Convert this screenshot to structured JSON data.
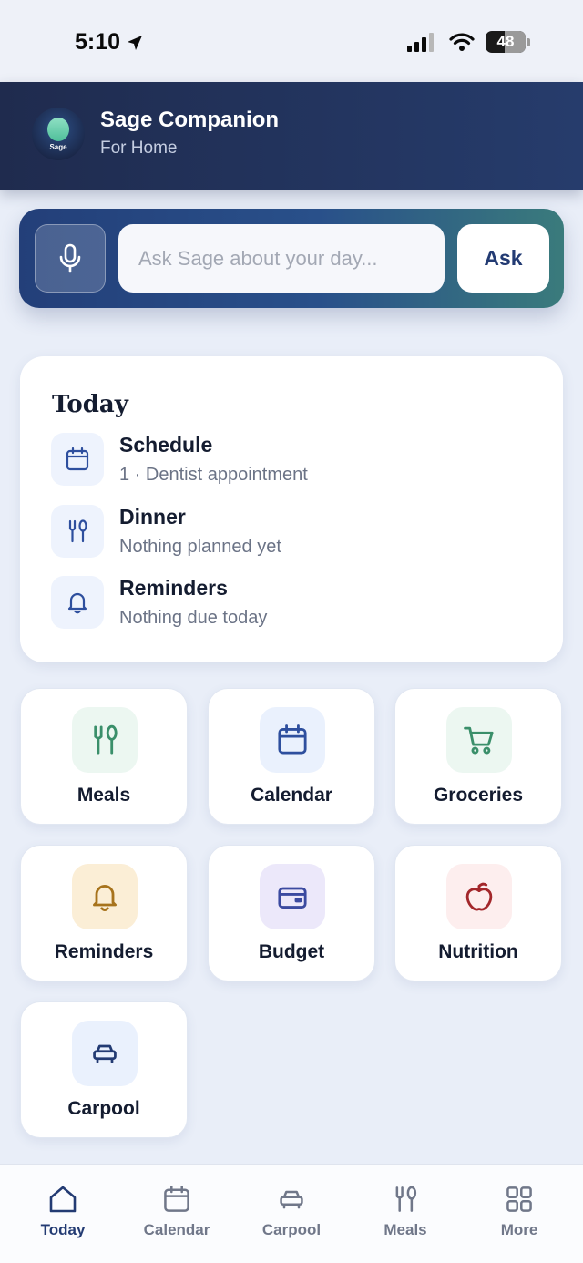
{
  "status_bar": {
    "time": "5:10",
    "battery": "48"
  },
  "header": {
    "title": "Sage Companion",
    "subtitle": "For Home",
    "logo_text": "Sage"
  },
  "ask": {
    "placeholder": "Ask Sage about your day...",
    "button_label": "Ask"
  },
  "today": {
    "title": "Today",
    "items": [
      {
        "label": "Schedule",
        "detail": "1 · Dentist appointment",
        "icon": "calendar-icon"
      },
      {
        "label": "Dinner",
        "detail": "Nothing planned yet",
        "icon": "utensils-icon"
      },
      {
        "label": "Reminders",
        "detail": "Nothing due today",
        "icon": "bell-icon"
      }
    ]
  },
  "tiles": [
    {
      "label": "Meals",
      "icon": "utensils-icon",
      "color": "#3a8f6a",
      "bg": "#ecf7f1"
    },
    {
      "label": "Calendar",
      "icon": "calendar-icon",
      "color": "#2e4f9e",
      "bg": "#eaf1fd"
    },
    {
      "label": "Groceries",
      "icon": "cart-icon",
      "color": "#3a8f6a",
      "bg": "#ecf7f1"
    },
    {
      "label": "Reminders",
      "icon": "bell-icon",
      "color": "#a7731c",
      "bg": "#fbeed6"
    },
    {
      "label": "Budget",
      "icon": "wallet-icon",
      "color": "#3b4aa0",
      "bg": "#ece8fa"
    },
    {
      "label": "Nutrition",
      "icon": "apple-icon",
      "color": "#a3272b",
      "bg": "#fdeeee"
    },
    {
      "label": "Carpool",
      "icon": "car-icon",
      "color": "#233b73",
      "bg": "#eaf1fd"
    }
  ],
  "nav": [
    {
      "label": "Today",
      "icon": "home-icon",
      "active": true
    },
    {
      "label": "Calendar",
      "icon": "calendar-icon",
      "active": false
    },
    {
      "label": "Carpool",
      "icon": "car-icon",
      "active": false
    },
    {
      "label": "Meals",
      "icon": "utensils-icon",
      "active": false
    },
    {
      "label": "More",
      "icon": "grid-icon",
      "active": false
    }
  ],
  "colors": {
    "primary": "#233b73",
    "header_bg": "#1f2b4e",
    "page_bg": "#e9eef8"
  }
}
